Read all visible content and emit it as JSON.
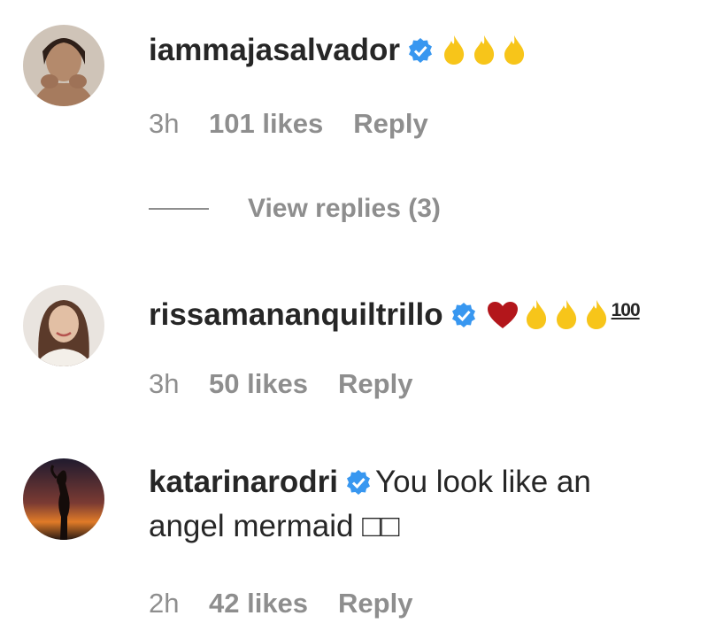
{
  "comments": [
    {
      "username": "iammajasalvador",
      "verified": true,
      "emoji": [
        "fire",
        "fire",
        "fire"
      ],
      "time": "3h",
      "likes": "101 likes",
      "reply": "Reply",
      "view_replies": "View replies (3)"
    },
    {
      "username": "rissamananquiltrillo",
      "verified": true,
      "emoji": [
        "heart",
        "fire",
        "fire",
        "fire",
        "hundred"
      ],
      "hundred_text": "100",
      "time": "3h",
      "likes": "50 likes",
      "reply": "Reply"
    },
    {
      "username": "katarinarodri",
      "verified": true,
      "text_line1": "You look like an",
      "text_line2": "angel mermaid □□",
      "time": "2h",
      "likes": "42 likes",
      "reply": "Reply"
    }
  ],
  "colors": {
    "verified": "#3897f0",
    "meta": "#8e8e8e",
    "fire": "#f7c51a",
    "heart": "#b3161b"
  }
}
